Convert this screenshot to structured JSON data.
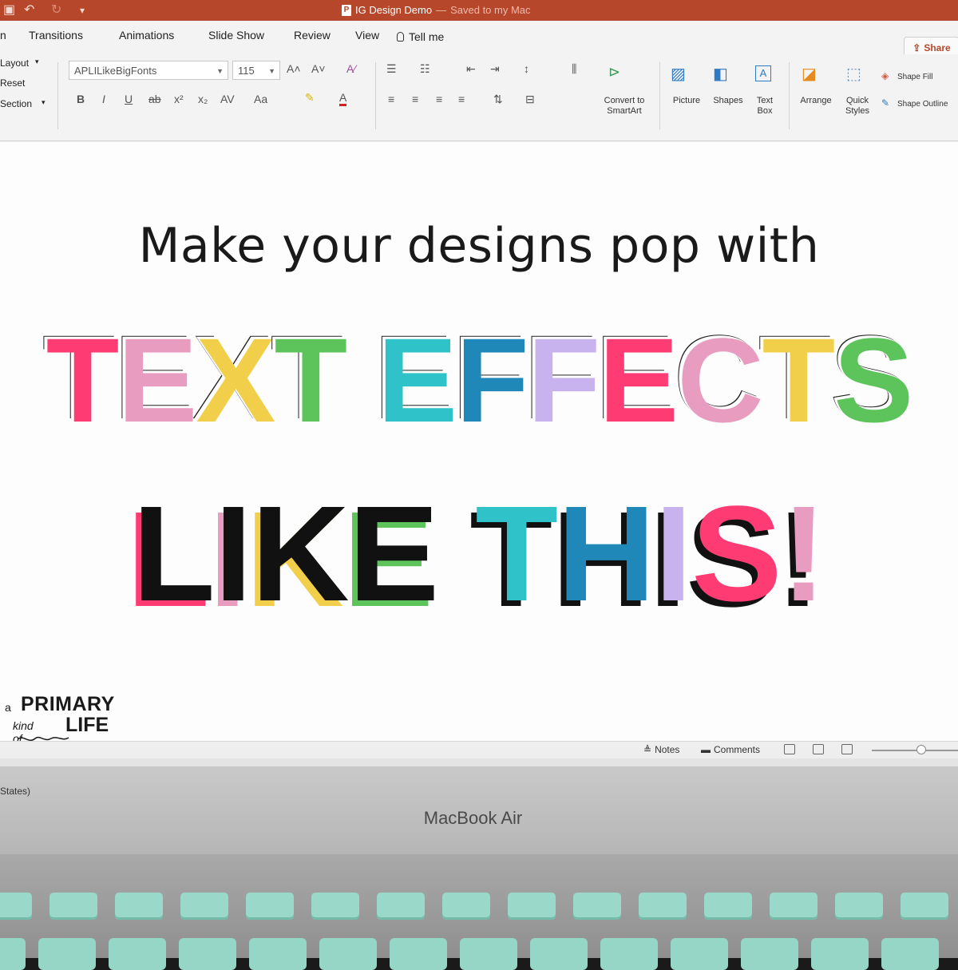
{
  "titlebar": {
    "doc_icon": "P",
    "doc_name": "IG Design Demo",
    "separator": "—",
    "doc_status": "Saved to my Mac",
    "accent_color": "#b7472a"
  },
  "tabs": {
    "items": [
      "Transitions",
      "Animations",
      "Slide Show",
      "Review",
      "View"
    ],
    "tell_me": "Tell me",
    "share": "Share"
  },
  "ribbon": {
    "slides_group": [
      "Layout",
      "Reset",
      "Section"
    ],
    "font_name": "APLILikeBigFonts",
    "font_size": "115",
    "convert_smartart": [
      "Convert to",
      "SmartArt"
    ],
    "picture": "Picture",
    "shapes": "Shapes",
    "text_box": [
      "Text",
      "Box"
    ],
    "arrange": "Arrange",
    "quick_styles": [
      "Quick",
      "Styles"
    ],
    "shape_fill": "Shape Fill",
    "shape_outline": "Shape Outline"
  },
  "slide": {
    "headline": "Make your designs pop with",
    "line1": [
      {
        "ch": "T",
        "color": "#ff3b73"
      },
      {
        "ch": "E",
        "color": "#e79cc0"
      },
      {
        "ch": "X",
        "color": "#f2cf4a"
      },
      {
        "ch": "T",
        "color": "#5cc45b"
      },
      {
        "ch": " ",
        "color": "#000000"
      },
      {
        "ch": "E",
        "color": "#2fc2c8"
      },
      {
        "ch": "F",
        "color": "#1f88b8"
      },
      {
        "ch": "F",
        "color": "#c9b3ee"
      },
      {
        "ch": "E",
        "color": "#ff3b73"
      },
      {
        "ch": "C",
        "color": "#e79cc0"
      },
      {
        "ch": "T",
        "color": "#f2cf4a"
      },
      {
        "ch": "S",
        "color": "#5cc45b"
      }
    ],
    "line2": [
      {
        "ch": "L",
        "color": "#111111",
        "shadow": "#ff3b73"
      },
      {
        "ch": "I",
        "color": "#111111",
        "shadow": "#e79cc0"
      },
      {
        "ch": "K",
        "color": "#111111",
        "shadow": "#f2cf4a"
      },
      {
        "ch": "E",
        "color": "#111111",
        "shadow": "#5cc45b"
      },
      {
        "ch": " ",
        "color": "#111111",
        "shadow": "#111111"
      },
      {
        "ch": "T",
        "color": "#2fc2c8",
        "shadow": "#111111"
      },
      {
        "ch": "H",
        "color": "#1f88b8",
        "shadow": "#111111"
      },
      {
        "ch": "I",
        "color": "#c9b3ee",
        "shadow": "#111111"
      },
      {
        "ch": "S",
        "color": "#ff3b73",
        "shadow": "#111111"
      },
      {
        "ch": "!",
        "color": "#e79cc0",
        "shadow": "#111111"
      }
    ],
    "logo": {
      "a": "a",
      "primary": "PRIMARY",
      "kind_of": "kind of",
      "life": "LIFE"
    }
  },
  "statusbar": {
    "notes": "Notes",
    "comments": "Comments"
  },
  "window_status": "States)",
  "laptop": {
    "brand": "MacBook Air",
    "key_color": "#8fd3c2"
  }
}
